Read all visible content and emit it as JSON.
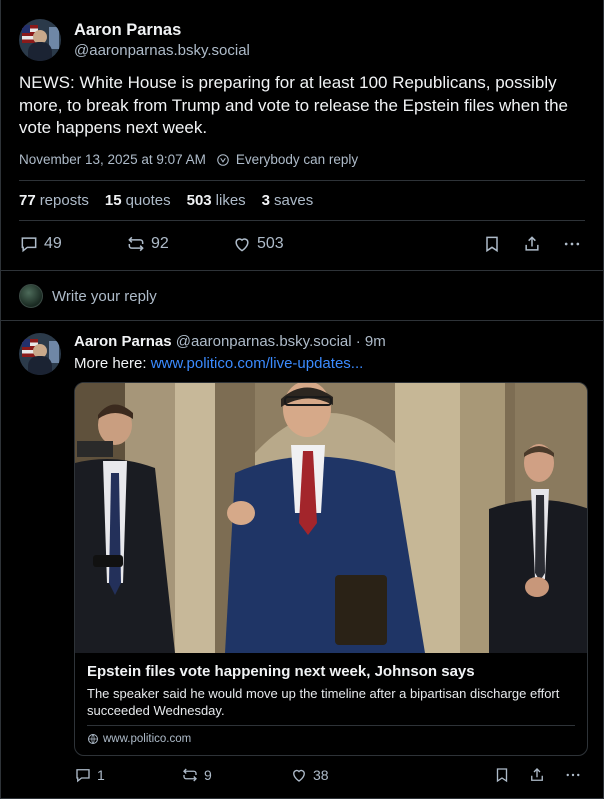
{
  "post": {
    "author_name": "Aaron Parnas",
    "author_handle": "@aaronparnas.bsky.social",
    "text": "NEWS: White House is preparing for at least 100 Republicans, possibly more, to break from Trump and vote to release the Epstein files when the vote happens next week.",
    "timestamp": "November 13, 2025 at 9:07 AM",
    "reply_setting": "Everybody can reply",
    "stats": {
      "reposts_count": "77",
      "reposts_label": "reposts",
      "quotes_count": "15",
      "quotes_label": "quotes",
      "likes_count": "503",
      "likes_label": "likes",
      "saves_count": "3",
      "saves_label": "saves"
    },
    "actions": {
      "replies": "49",
      "reposts": "92",
      "likes": "503"
    }
  },
  "reply_box": {
    "placeholder": "Write your reply"
  },
  "reply": {
    "author_name": "Aaron Parnas",
    "author_meta": "@aaronparnas.bsky.social · 9m",
    "text_prefix": "More here: ",
    "link_text": "www.politico.com/live-updates...",
    "card": {
      "title": "Epstein files vote happening next week, Johnson says",
      "description": "The speaker said he would move up the timeline after a bipartisan discharge effort succeeded Wednesday.",
      "domain": "www.politico.com"
    },
    "actions": {
      "replies": "1",
      "reposts": "9",
      "likes": "38"
    }
  },
  "icons": {
    "reply": "reply-icon",
    "repost": "repost-icon",
    "like": "heart-icon",
    "bookmark": "bookmark-icon",
    "share": "share-icon",
    "more": "more-icon",
    "globe": "globe-icon"
  },
  "colors": {
    "background": "#000000",
    "text": "#f1f3f5",
    "muted": "#aebbc9",
    "link": "#3b8bff",
    "divider": "#2e3338"
  }
}
